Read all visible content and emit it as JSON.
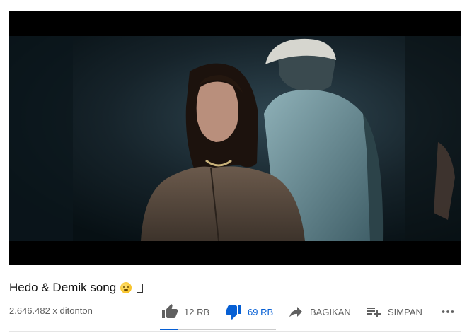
{
  "video": {
    "title": "Hedo & Demik song",
    "title_emoji": "smiling-face-emoji",
    "views": "2.646.482 x ditonton"
  },
  "actions": {
    "like_count": "12 RB",
    "dislike_count": "69 RB",
    "share_label": "BAGIKAN",
    "save_label": "SIMPAN",
    "more_icon": "more-horizontal-icon"
  },
  "sentiment": {
    "like_fraction": 0.15
  },
  "colors": {
    "accent": "#065fd4",
    "secondary_text": "#606060",
    "icon": "#606060"
  }
}
